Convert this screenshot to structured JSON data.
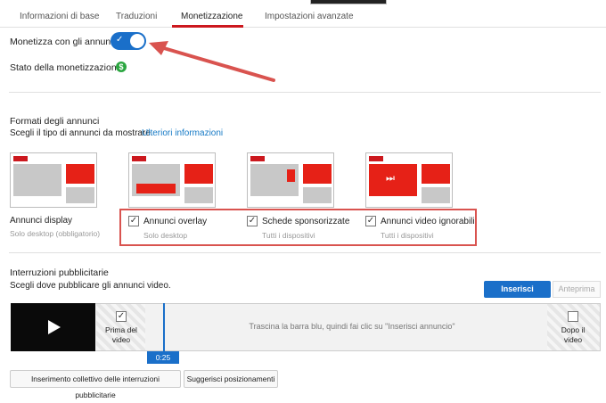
{
  "tabs": [
    "Informazioni di base",
    "Traduzioni",
    "Monetizzazione",
    "Impostazioni avanzate"
  ],
  "monetize": {
    "label": "Monetizza con gli annunci",
    "enabled": true,
    "status_label": "Stato della monetizzazione:",
    "status_icon": "dollar-icon"
  },
  "ad_formats": {
    "title": "Formati degli annunci",
    "subtitle": "Scegli il tipo di annunci da mostrare.",
    "link": "Ulteriori informazioni",
    "items": [
      {
        "label": "Annunci display",
        "note": "Solo desktop (obbligatorio)",
        "checkbox": false
      },
      {
        "label": "Annunci overlay",
        "note": "Solo desktop",
        "checkbox": true,
        "checked": true
      },
      {
        "label": "Schede sponsorizzate",
        "note": "Tutti i dispositivi",
        "checkbox": true,
        "checked": true
      },
      {
        "label": "Annunci video ignorabili",
        "note": "Tutti i dispositivi",
        "checkbox": true,
        "checked": true
      }
    ]
  },
  "breaks": {
    "title": "Interruzioni pubblicitarie",
    "subtitle": "Scegli dove pubblicare gli annunci video.",
    "insert_button": "Inserisci annuncio",
    "preview_button": "Anteprima",
    "pre_roll": "Prima del video",
    "post_roll": "Dopo il video",
    "hint": "Trascina la barra blu, quindi fai clic su \"Inserisci annuncio\"",
    "time": "0:25",
    "bulk_button": "Inserimento collettivo delle interruzioni pubblicitarie",
    "suggest_button": "Suggerisci posizionamenti"
  },
  "colors": {
    "accent": "#1a6fc9",
    "youtube_red": "#e62117",
    "success": "#2ba640",
    "annotation_red": "#d9534f"
  }
}
